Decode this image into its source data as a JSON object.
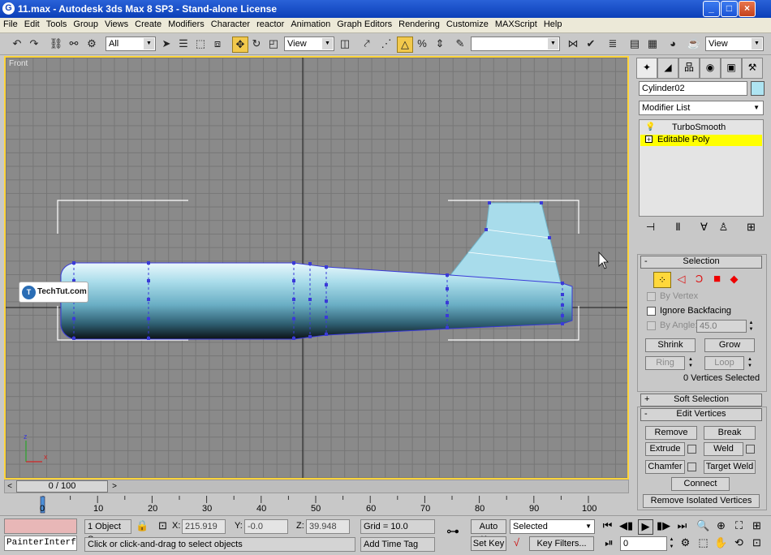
{
  "window": {
    "title": "11.max - Autodesk 3ds Max 8 SP3   - Stand-alone License",
    "minimize_glyph": "_",
    "maximize_glyph": "□",
    "close_glyph": "×"
  },
  "menu": [
    "File",
    "Edit",
    "Tools",
    "Group",
    "Views",
    "Create",
    "Modifiers",
    "Character",
    "reactor",
    "Animation",
    "Graph Editors",
    "Rendering",
    "Customize",
    "MAXScript",
    "Help"
  ],
  "toolbar": {
    "selection_filter": "All",
    "reference_coord": "View",
    "named_selection": "",
    "view_dropdown": "View"
  },
  "viewport": {
    "label": "Front",
    "axis_z": "z",
    "axis_x": "x",
    "watermark": "TechTut.com",
    "watermark_logo": "T"
  },
  "command_panel": {
    "object_name": "Cylinder02",
    "modifier_list": "Modifier List",
    "stack": [
      {
        "name": "TurboSmooth",
        "selected": false
      },
      {
        "name": "Editable Poly",
        "selected": true
      }
    ],
    "selection_rollout": {
      "title": "Selection",
      "by_vertex": "By Vertex",
      "ignore_backfacing": "Ignore Backfacing",
      "by_angle": "By Angle:",
      "angle_value": "45.0",
      "shrink": "Shrink",
      "grow": "Grow",
      "ring": "Ring",
      "loop": "Loop",
      "status": "0 Vertices Selected"
    },
    "soft_selection": "Soft Selection",
    "edit_vertices": {
      "title": "Edit Vertices",
      "remove": "Remove",
      "break": "Break",
      "extrude": "Extrude",
      "weld": "Weld",
      "chamfer": "Chamfer",
      "target_weld": "Target Weld",
      "connect": "Connect",
      "remove_isolated": "Remove Isolated Vertices"
    }
  },
  "timeline": {
    "slider": "0 / 100",
    "ticks": [
      "0",
      "10",
      "20",
      "30",
      "40",
      "50",
      "60",
      "70",
      "80",
      "90",
      "100"
    ]
  },
  "status": {
    "maxscript": "PainterInterf",
    "selection": "1 Object Se",
    "x_label": "X:",
    "x": "215.919",
    "y_label": "Y:",
    "y": "-0.0",
    "z_label": "Z:",
    "z": "39.948",
    "grid": "Grid = 10.0",
    "prompt": "Click or click-and-drag to select objects",
    "add_time_tag": "Add Time Tag",
    "auto_key": "Auto Key",
    "set_key": "Set Key",
    "key_mode": "Selected",
    "key_filters": "Key Filters...",
    "frame": "0"
  },
  "colors": {
    "viewport_border": "#ffd43b",
    "selected_modifier": "#ffff00",
    "vertex": "#3a3ad8"
  }
}
